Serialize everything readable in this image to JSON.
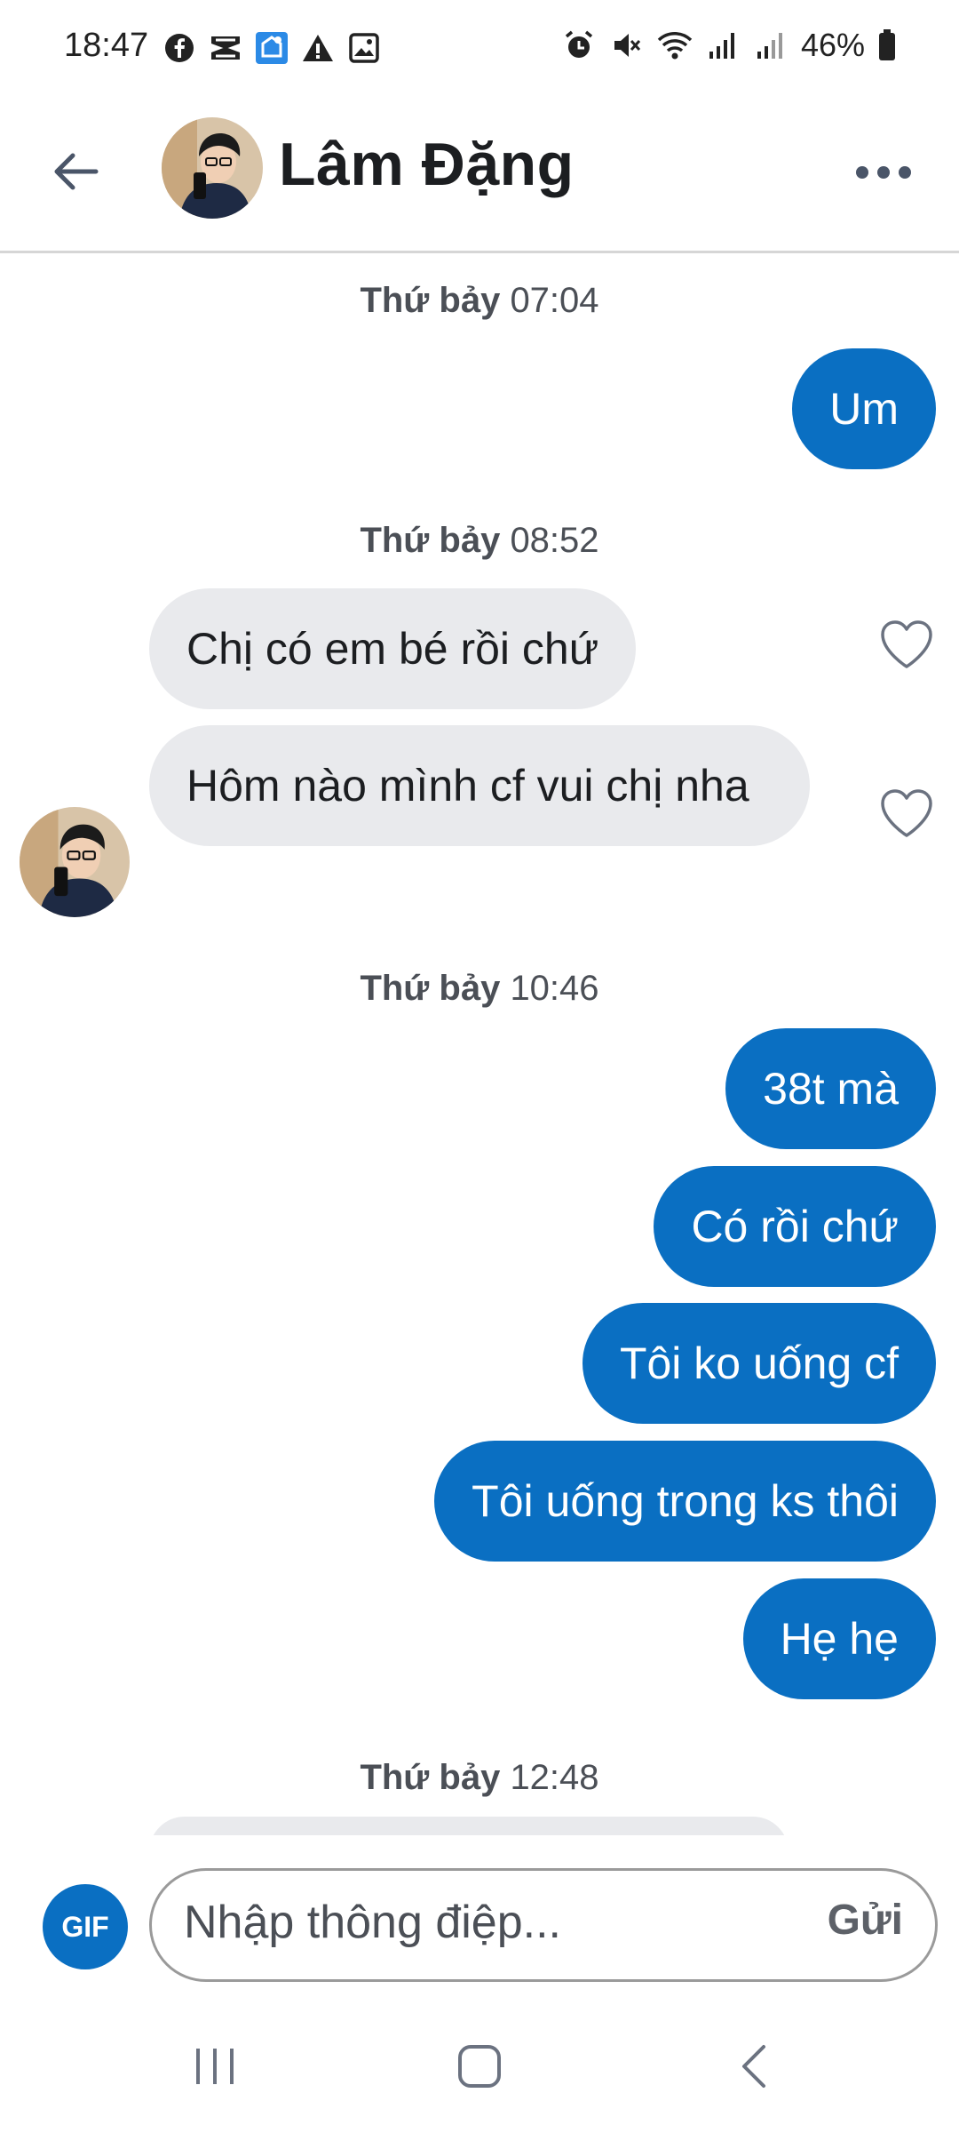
{
  "status_bar": {
    "time": "18:47",
    "battery": "46%",
    "notification_icons": [
      "facebook-icon",
      "capcut-icon",
      "gallery-sync-icon",
      "warning-icon",
      "image-icon"
    ],
    "system_icons": [
      "alarm-icon",
      "mute-icon",
      "wifi-icon",
      "signal-icon",
      "signal-icon",
      "battery-icon"
    ]
  },
  "header": {
    "contact_name": "Lâm Đặng"
  },
  "conversation": [
    {
      "type": "timestamp",
      "day": "Thứ bảy",
      "time": "07:04"
    },
    {
      "type": "outgoing",
      "text": "Um"
    },
    {
      "type": "timestamp",
      "day": "Thứ bảy",
      "time": "08:52"
    },
    {
      "type": "incoming",
      "text": "Chị có em bé rồi chứ"
    },
    {
      "type": "incoming",
      "text": "Hôm nào mình cf vui chị nha"
    },
    {
      "type": "timestamp",
      "day": "Thứ bảy",
      "time": "10:46"
    },
    {
      "type": "outgoing",
      "text": "38t mà"
    },
    {
      "type": "outgoing",
      "text": "Có rồi chứ"
    },
    {
      "type": "outgoing",
      "text": "Tôi ko uống cf"
    },
    {
      "type": "outgoing",
      "text": "Tôi uống trong ks thôi"
    },
    {
      "type": "outgoing",
      "text": "Hẹ hẹ"
    },
    {
      "type": "timestamp",
      "day": "Thứ bảy",
      "time": "12:48"
    }
  ],
  "composer": {
    "gif_label": "GIF",
    "placeholder": "Nhập thông điệp...",
    "send_label": "Gửi"
  },
  "colors": {
    "outgoing_bubble": "#0a6fc2",
    "incoming_bubble": "#e9eaed",
    "accent": "#0a6fc2"
  }
}
